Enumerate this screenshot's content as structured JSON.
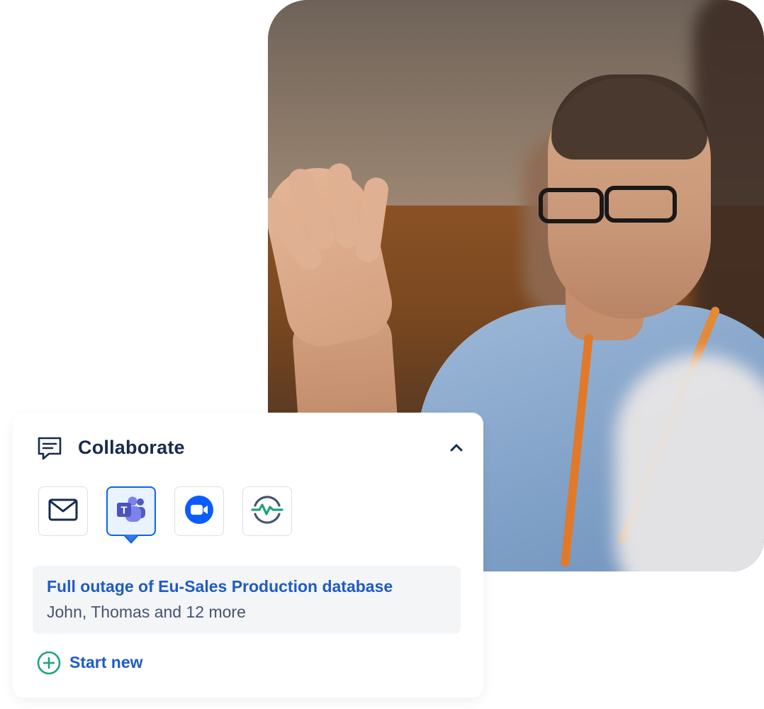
{
  "card": {
    "title": "Collaborate",
    "apps": [
      {
        "name": "email",
        "icon": "envelope-icon"
      },
      {
        "name": "teams",
        "icon": "microsoft-teams-icon",
        "selected": true
      },
      {
        "name": "zoom",
        "icon": "zoom-video-icon"
      },
      {
        "name": "monitor",
        "icon": "status-monitor-icon"
      }
    ],
    "thread": {
      "title": "Full outage of Eu-Sales Production database",
      "participants": "John, Thomas and",
      "more": "12 more"
    },
    "start_new": "Start new"
  },
  "colors": {
    "title": "#172b4d",
    "link": "#1f5bc4",
    "selected_border": "#0c66e4",
    "zoom_blue": "#0b5cff",
    "teams_purple": "#5059c9",
    "monitor_green": "#1fa37a"
  }
}
